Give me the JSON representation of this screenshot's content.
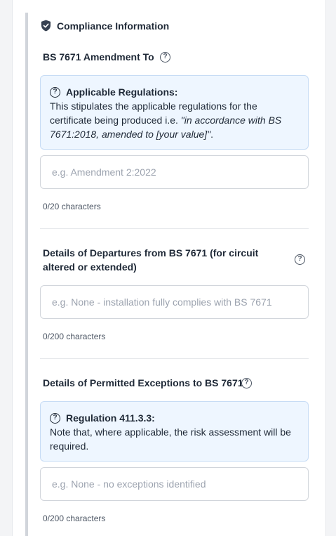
{
  "section": {
    "title": "Compliance Information",
    "icon": "shield-check-icon"
  },
  "amendment": {
    "label": "BS 7671 Amendment To",
    "info_title": "Applicable Regulations:",
    "info_text_plain": "This stipulates the applicable regulations for the certificate being produced i.e. ",
    "info_text_italic": "\"in accordance with BS 7671:2018, amended to [your value]\"",
    "info_text_end": ".",
    "placeholder": "e.g. Amendment 2:2022",
    "value": "",
    "counter": "0/20 characters"
  },
  "departures": {
    "label": "Details of Departures from BS 7671 (for circuit altered or extended)",
    "placeholder": "e.g. None - installation fully complies with BS 7671",
    "value": "",
    "counter": "0/200 characters"
  },
  "exceptions": {
    "label": "Details of Permitted Exceptions to BS 7671",
    "info_title": "Regulation 411.3.3:",
    "info_text": "Note that, where applicable, the risk assessment will be required.",
    "placeholder": "e.g. None - no exceptions identified",
    "value": "",
    "counter": "0/200 characters"
  },
  "colors": {
    "info_bg": "#eef6ff",
    "info_border": "#c7dcf5",
    "accent_bar": "#d1d5db"
  }
}
